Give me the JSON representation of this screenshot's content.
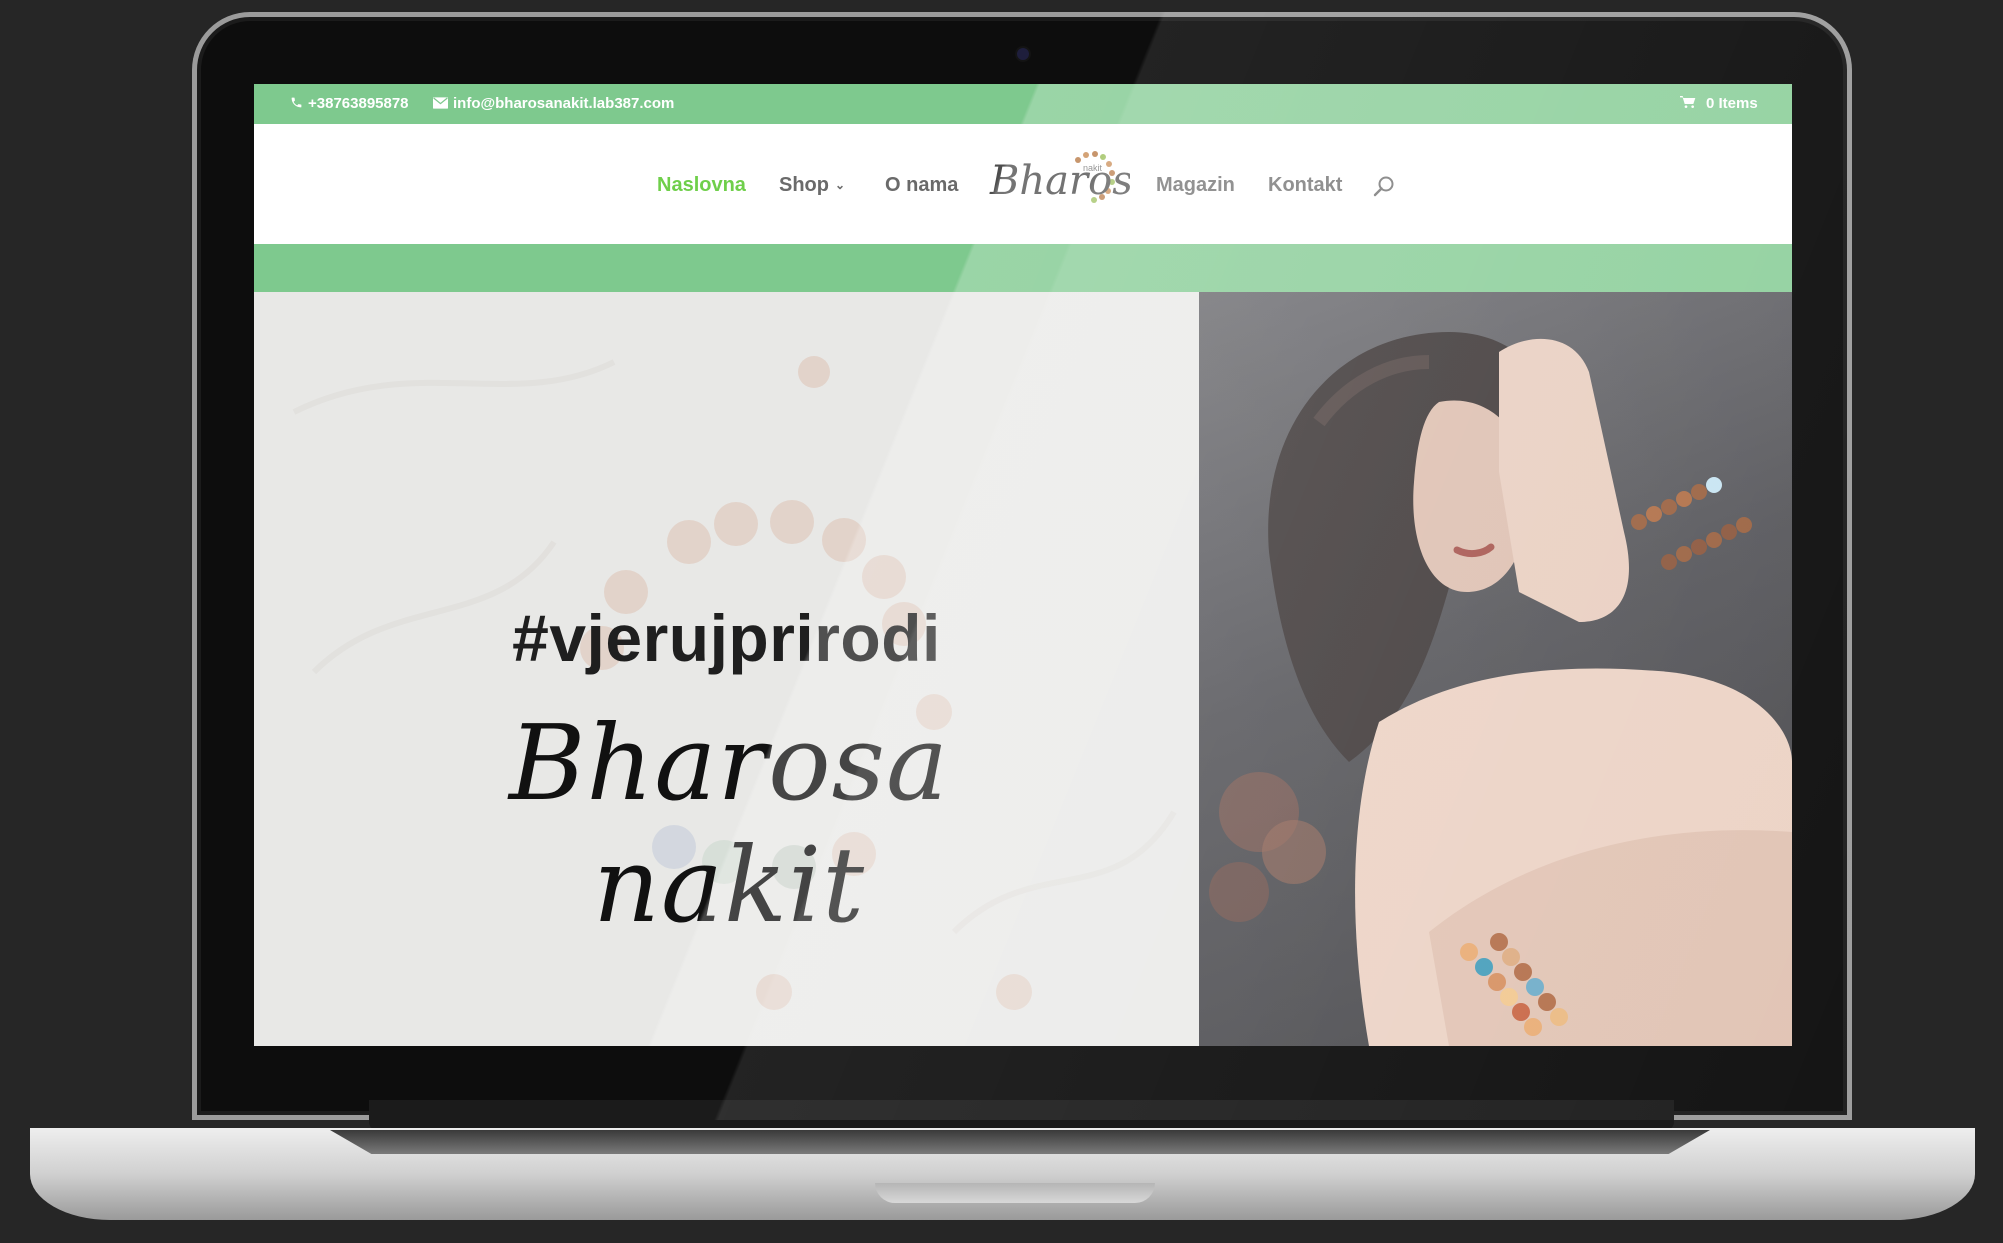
{
  "topbar": {
    "phone": "+38763895878",
    "email": "info@bharosanakit.lab387.com",
    "cart": "0 Items",
    "phone_icon": "phone-icon",
    "email_icon": "envelope-icon",
    "cart_icon": "cart-icon"
  },
  "nav": {
    "items": [
      {
        "label": "Naslovna",
        "active": true
      },
      {
        "label": "Shop",
        "has_dropdown": true
      },
      {
        "label": "O nama"
      },
      {
        "label": "Magazin"
      },
      {
        "label": "Kontakt"
      }
    ],
    "search_icon": "search-icon",
    "logo_text": "Bharosa",
    "logo_small_text": "nakit"
  },
  "hero": {
    "hashtag": "#vjerujprirodi",
    "title": "Bharosa nakit"
  },
  "colors": {
    "accent_green": "#7ec98e",
    "active_nav": "#6fcf4a",
    "nav_text": "#6a6a6a",
    "page_bg": "#262626"
  }
}
